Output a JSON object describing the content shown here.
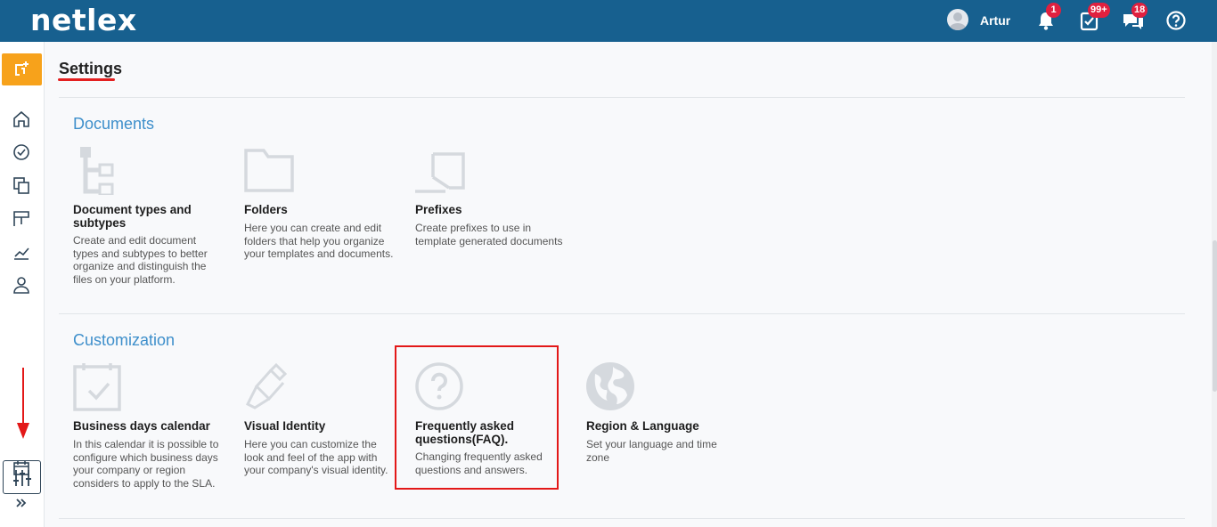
{
  "header": {
    "logo": "netlex",
    "user_name": "Artur",
    "notifications_badge": "1",
    "tasks_badge": "99+",
    "messages_badge": "18"
  },
  "page": {
    "title": "Settings"
  },
  "sections": {
    "documents": {
      "title": "Documents",
      "cards": [
        {
          "icon": "document-tree-icon",
          "title": "Document types and subtypes",
          "desc": "Create and edit document types and subtypes to better organize and distinguish the files on your platform."
        },
        {
          "icon": "folder-icon",
          "title": "Folders",
          "desc": "Here you can create and edit folders that help you organize your templates and documents."
        },
        {
          "icon": "prefix-icon",
          "title": "Prefixes",
          "desc": "Create prefixes to use in template generated documents"
        }
      ]
    },
    "customization": {
      "title": "Customization",
      "cards": [
        {
          "icon": "calendar-check-icon",
          "title": "Business days calendar",
          "desc": "In this calendar it is possible to configure which business days your company or region considers to apply to the SLA."
        },
        {
          "icon": "paint-brush-icon",
          "title": "Visual Identity",
          "desc": "Here you can customize the look and feel of the app with your company's visual identity."
        },
        {
          "icon": "question-circle-icon",
          "title": "Frequently asked questions(FAQ).",
          "desc": "Changing frequently asked questions and answers."
        },
        {
          "icon": "globe-icon",
          "title": "Region & Language",
          "desc": "Set your language and time zone"
        }
      ]
    }
  },
  "colors": {
    "header": "#17608f",
    "accent": "#3e8fcb",
    "new_button": "#f7a21b",
    "badge": "#e0203f",
    "annotation": "#e31818"
  }
}
